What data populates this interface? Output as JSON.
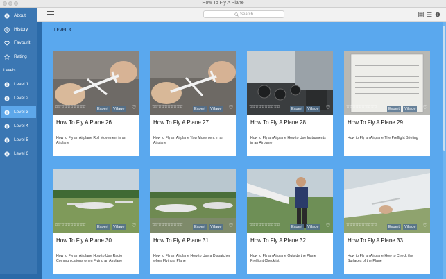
{
  "window": {
    "title": "How To Fly A Plane"
  },
  "search": {
    "placeholder": "Search"
  },
  "sidebar": {
    "menu": [
      {
        "label": "About",
        "icon": "info-icon"
      },
      {
        "label": "History",
        "icon": "clock-icon"
      },
      {
        "label": "Favourit",
        "icon": "heart-icon"
      },
      {
        "label": "Rating",
        "icon": "star-icon"
      }
    ],
    "section_label": "Levels",
    "levels": [
      {
        "label": "Level 1"
      },
      {
        "label": "Level 2"
      },
      {
        "label": "Level 3",
        "active": true
      },
      {
        "label": "Level 4"
      },
      {
        "label": "Level 5"
      },
      {
        "label": "Level 6"
      }
    ]
  },
  "main": {
    "level_heading": "LEVEL 3",
    "cards": [
      {
        "title": "How To Fly A Plane 26",
        "badge1": "Expert",
        "badge2": "Village",
        "stars": "☆☆☆☆☆☆☆☆☆☆",
        "desc": "How to Fly an Airplane  Roll Movement in an Airplane"
      },
      {
        "title": "How To Fly A Plane 27",
        "badge1": "Expert",
        "badge2": "Village",
        "stars": "☆☆☆☆☆☆☆☆☆☆",
        "desc": "How to Fly an Airplane  Yaw Movement in an Airplane"
      },
      {
        "title": "How To Fly A Plane 28",
        "badge1": "Expert",
        "badge2": "Village",
        "stars": "☆☆☆☆☆☆☆☆☆☆",
        "desc": "How to Fly an Airplane  How to Use Instruments in an Airplane"
      },
      {
        "title": "How To Fly A Plane 29",
        "badge1": "Expert",
        "badge2": "Village",
        "stars": "☆☆☆☆☆☆☆☆☆☆",
        "desc": "How to Fly an Airplane  The Preflight Briefing"
      },
      {
        "title": "How To Fly A Plane 30",
        "badge1": "Expert",
        "badge2": "Village",
        "stars": "☆☆☆☆☆☆☆☆☆☆",
        "desc": "How to Fly an Airplane  How to Use Radio Communications when Flying an Airplane"
      },
      {
        "title": "How To Fly A Plane 31",
        "badge1": "Expert",
        "badge2": "Village",
        "stars": "☆☆☆☆☆☆☆☆☆☆",
        "desc": "How to Fly an Airplane  How to Use a Dispatcher when Flying a Plane"
      },
      {
        "title": "How To Fly A Plane 32",
        "badge1": "Expert",
        "badge2": "Village",
        "stars": "☆☆☆☆☆☆☆☆☆☆",
        "desc": "How to Fly an Airplane  Outside the Plane Preflight Checklist"
      },
      {
        "title": "How To Fly A Plane 33",
        "badge1": "Expert",
        "badge2": "Village",
        "stars": "☆☆☆☆☆☆☆☆☆☆",
        "desc": "How to Fly an Airplane  How to Check the Surfaces of the Plane"
      }
    ]
  },
  "colors": {
    "sidebar_bg": "#3b77b3",
    "sidebar_active": "#5da7ea",
    "content_bg": "#5aa8ee",
    "card_bg": "#ffffff"
  }
}
